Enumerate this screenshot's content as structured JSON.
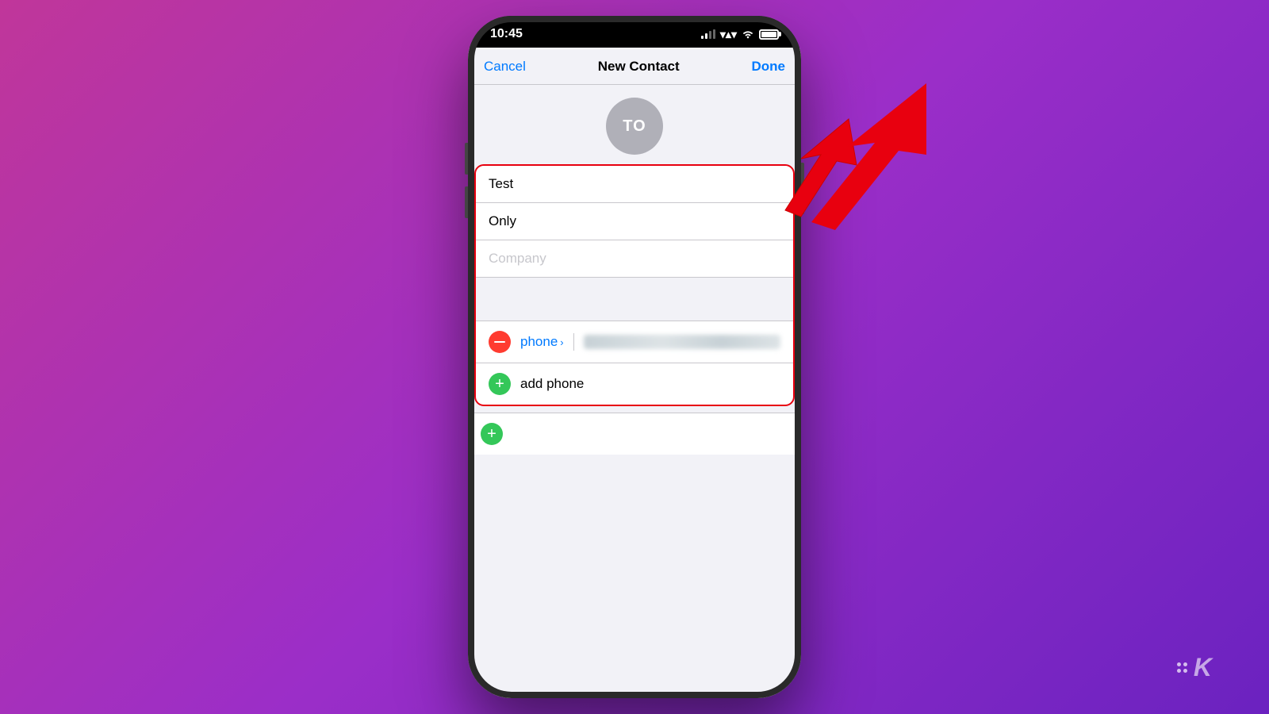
{
  "page": {
    "background": "gradient-purple-pink"
  },
  "status_bar": {
    "time": "10:45",
    "signal": "2 bars",
    "wifi": "on",
    "battery": "full"
  },
  "nav_bar": {
    "cancel_label": "Cancel",
    "title": "New Contact",
    "done_label": "Done"
  },
  "avatar": {
    "initials": "TO"
  },
  "form": {
    "first_name": "Test",
    "last_name": "Only",
    "company_placeholder": "Company",
    "phone_label": "phone",
    "phone_number_blurred": true,
    "add_phone_label": "add phone"
  },
  "annotation": {
    "arrow": "red-arrow pointing to Done button"
  },
  "watermark": {
    "symbol": "✦K",
    "text": "K"
  }
}
